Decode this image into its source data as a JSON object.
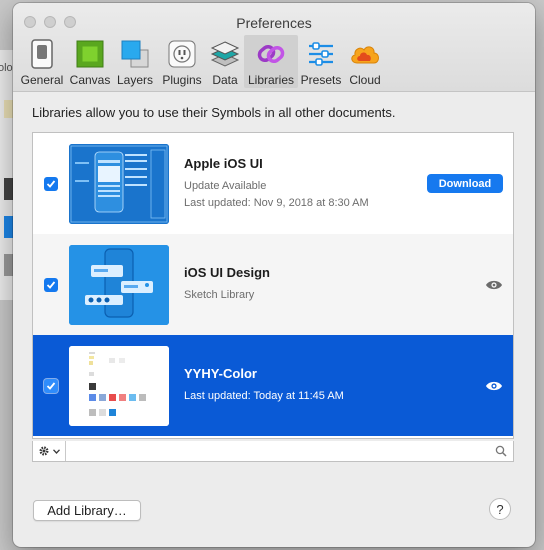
{
  "background_app": {
    "partial_text": "olo"
  },
  "window": {
    "title": "Preferences",
    "toolbar": [
      {
        "label": "General",
        "icon": "general-icon"
      },
      {
        "label": "Canvas",
        "icon": "canvas-icon"
      },
      {
        "label": "Layers",
        "icon": "layers-icon"
      },
      {
        "label": "Plugins",
        "icon": "plugins-icon"
      },
      {
        "label": "Data",
        "icon": "data-icon"
      },
      {
        "label": "Libraries",
        "icon": "libraries-icon",
        "active": true
      },
      {
        "label": "Presets",
        "icon": "presets-icon"
      },
      {
        "label": "Cloud",
        "icon": "cloud-icon"
      }
    ],
    "intro": "Libraries allow you to use their Symbols in all other documents.",
    "libraries": [
      {
        "name": "Apple iOS UI",
        "line1": "Update Available",
        "line2": "Last updated: Nov 9, 2018 at 8:30 AM",
        "checked": true,
        "action": "Download"
      },
      {
        "name": "iOS UI Design",
        "line1": "Sketch Library",
        "line2": "",
        "checked": true
      },
      {
        "name": "YYHY-Color",
        "line1": "Last updated: Today at 11:45 AM",
        "line2": "",
        "checked": true,
        "selected": true
      }
    ],
    "add_library_label": "Add Library…",
    "help_label": "?"
  },
  "colors": {
    "accent": "#1479ef",
    "selection": "#0a5ad6"
  }
}
